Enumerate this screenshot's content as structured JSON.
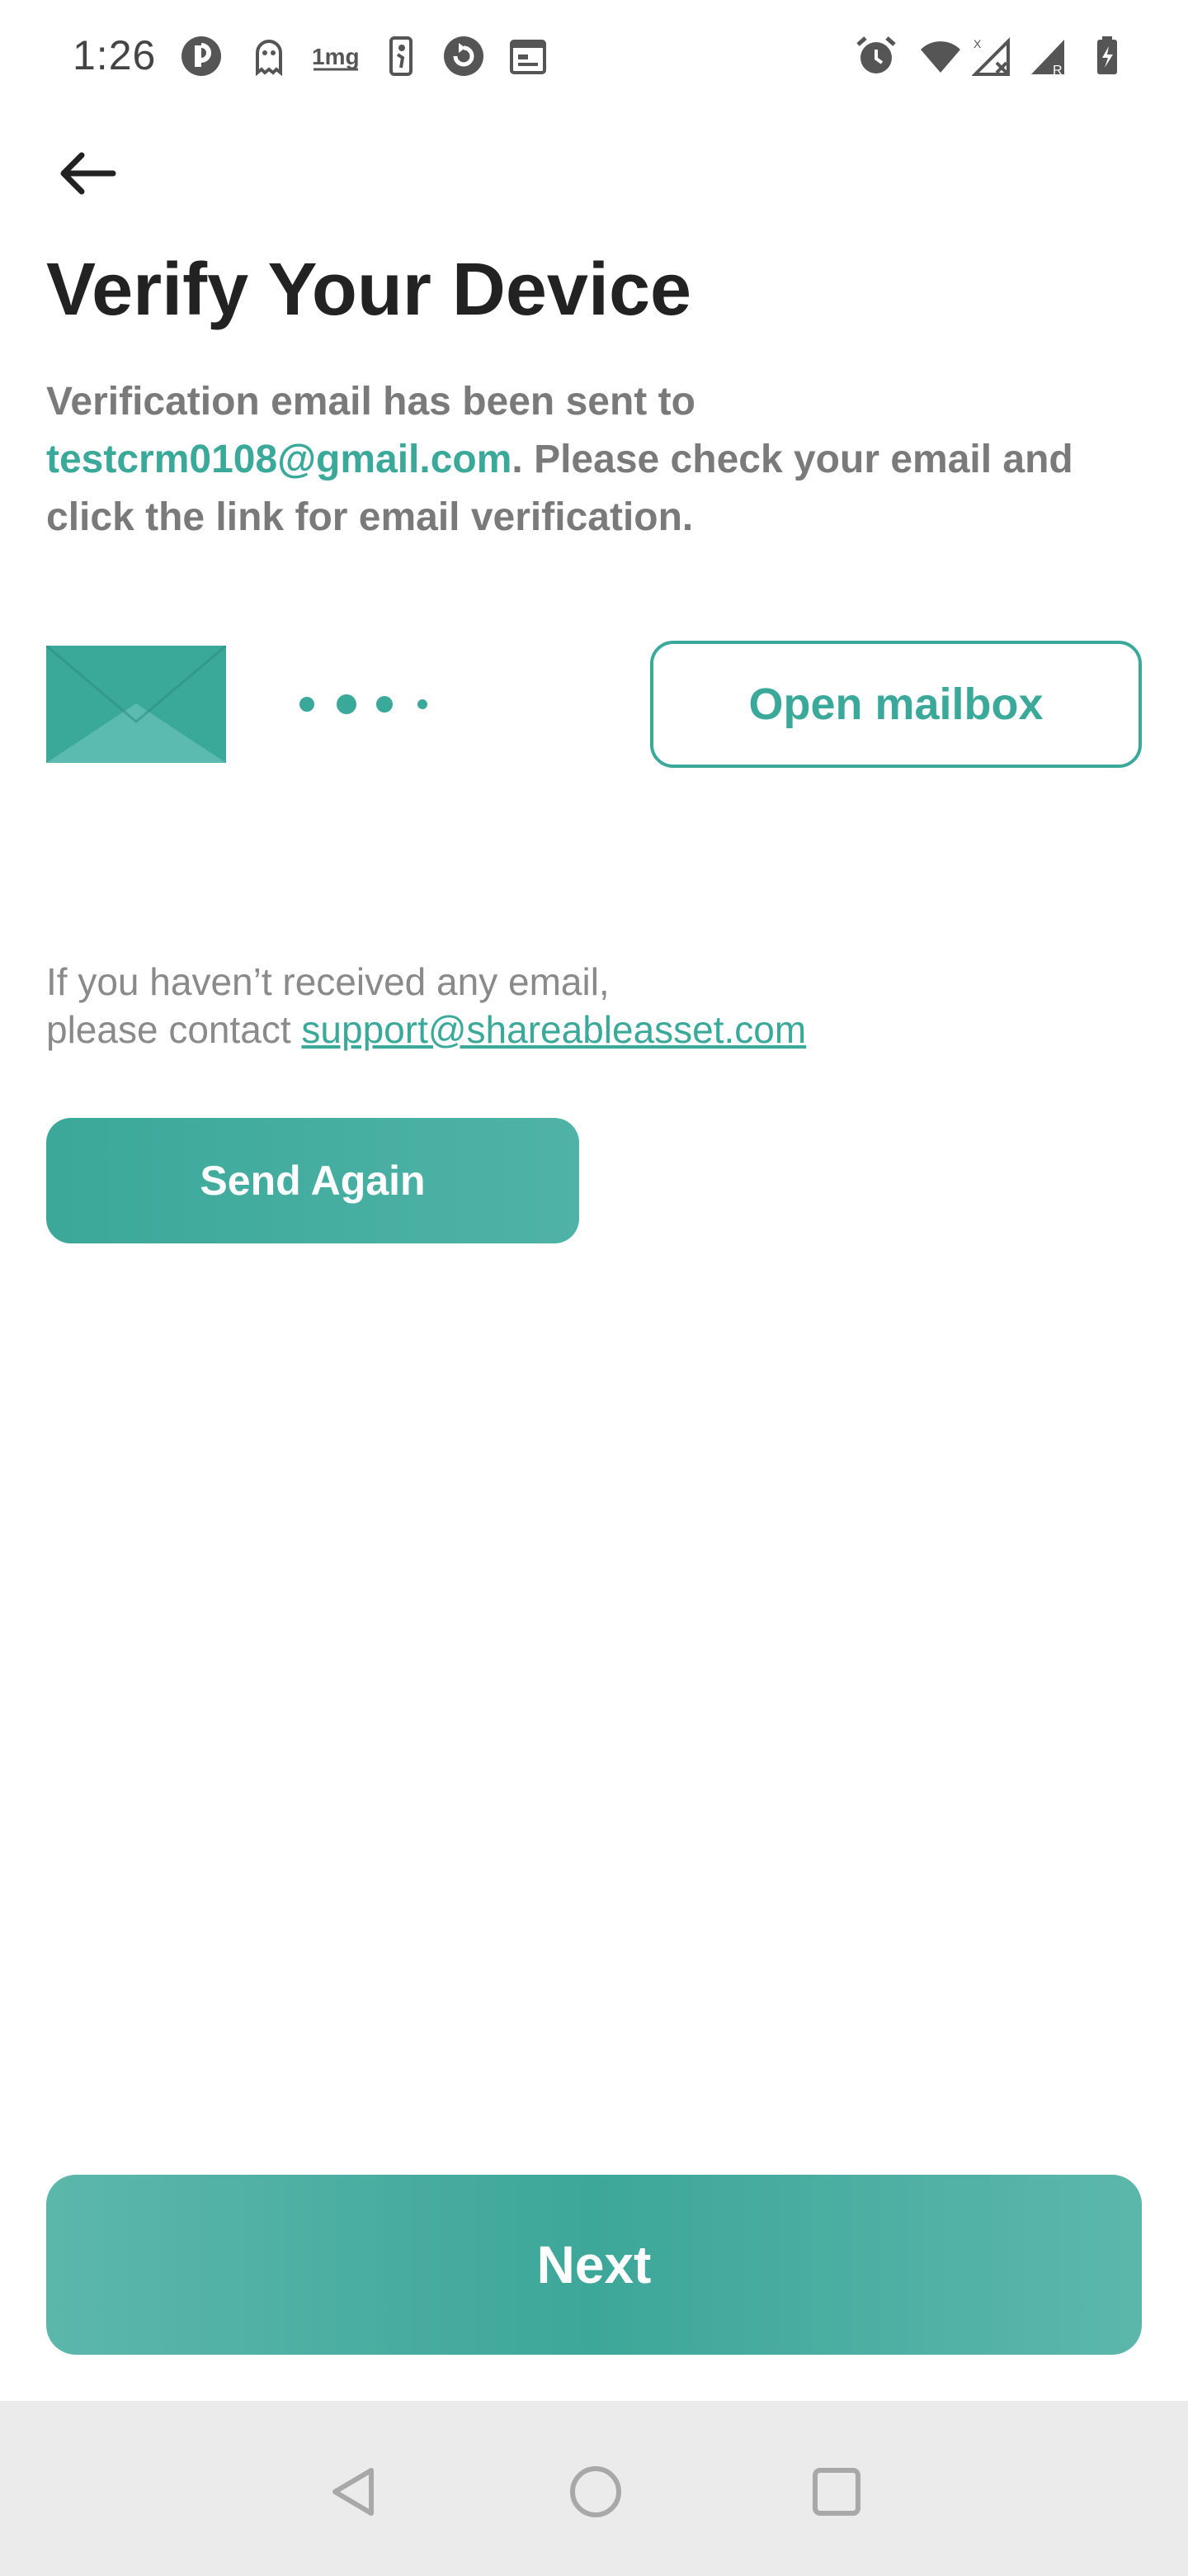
{
  "status_bar": {
    "time": "1:26",
    "left_icons": [
      "circle-r-icon",
      "ghost-icon",
      "1mg-icon",
      "nba-icon",
      "refresh-circle-icon",
      "calendar-icon"
    ],
    "right_icons": [
      "alarm-icon",
      "wifi-icon",
      "signal-x-icon",
      "signal-r-icon",
      "battery-charging-icon"
    ],
    "onemg_label": "1mg"
  },
  "header": {
    "title": "Verify Your Device"
  },
  "description": {
    "prefix": "Verification email has been sent to ",
    "email": "testcrm0108@gmail.com",
    "suffix": ". Please check your email and click the link for email verification."
  },
  "mailbox": {
    "open_label": "Open mailbox"
  },
  "help": {
    "line1": "If you haven’t received any email,",
    "line2_prefix": "please contact ",
    "support_email": "support@shareableasset.com"
  },
  "actions": {
    "send_again_label": "Send Again",
    "next_label": "Next"
  },
  "colors": {
    "accent": "#3aa99a",
    "text_dark": "#222222",
    "text_gray": "#7a7a7a",
    "nav_bg": "#ebebeb"
  }
}
